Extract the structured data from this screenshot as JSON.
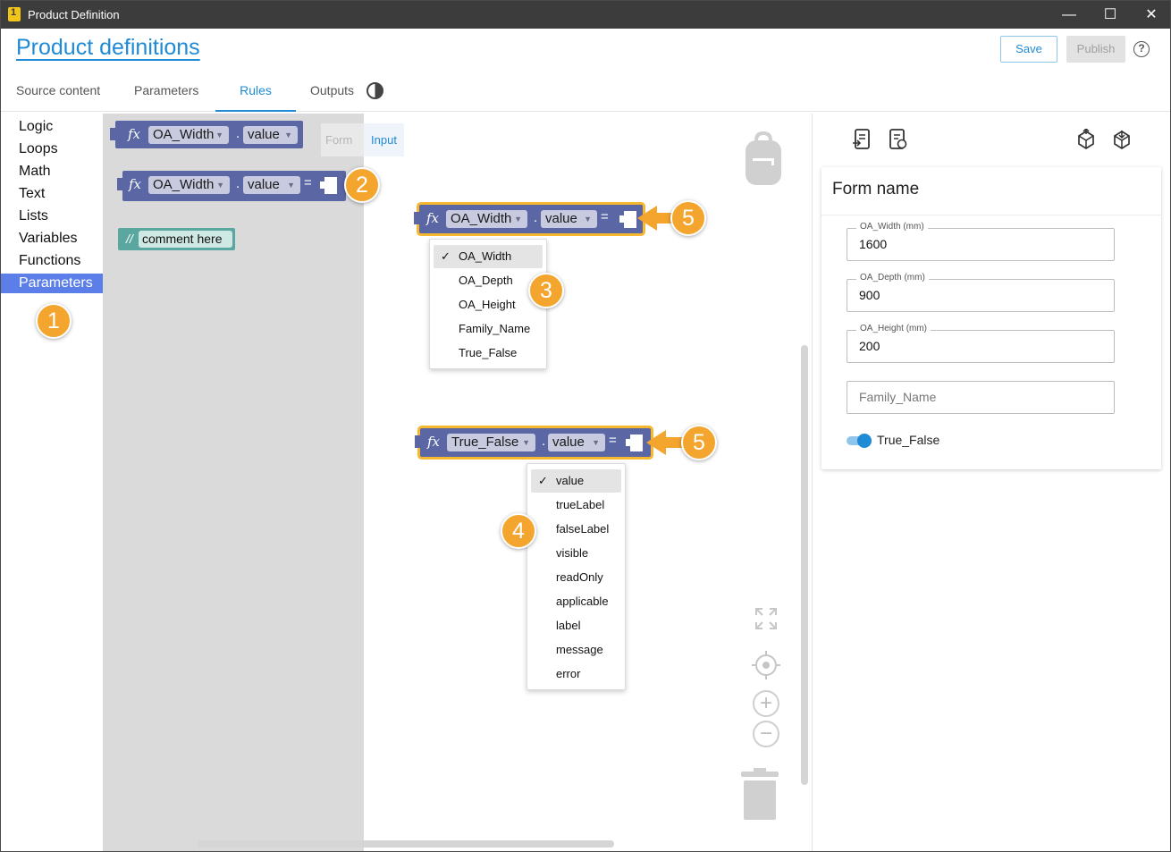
{
  "window": {
    "title": "Product Definition",
    "minimize": "—",
    "maximize": "☐",
    "close": "✕"
  },
  "header": {
    "title": "Product definitions",
    "save_label": "Save",
    "publish_label": "Publish",
    "help": "?"
  },
  "tabs": [
    {
      "label": "Source content"
    },
    {
      "label": "Parameters"
    },
    {
      "label": "Rules",
      "active": true
    },
    {
      "label": "Outputs"
    }
  ],
  "categories": [
    "Logic",
    "Loops",
    "Math",
    "Text",
    "Lists",
    "Variables",
    "Functions",
    "Parameters"
  ],
  "selected_category": "Parameters",
  "flyout_tabs": {
    "form": "Form",
    "input": "Input"
  },
  "flyout_blocks": {
    "getter": {
      "fx": "fx",
      "param": "OA_Width",
      "prop": "value",
      "dot": "."
    },
    "setter": {
      "fx": "fx",
      "param": "OA_Width",
      "prop": "value",
      "dot": ".",
      "eq": "="
    },
    "comment": {
      "slash": "//",
      "text": "comment here"
    }
  },
  "workspace_blocks": {
    "block1": {
      "fx": "fx",
      "param": "OA_Width",
      "prop": "value",
      "dot": ".",
      "eq": "="
    },
    "block2": {
      "fx": "fx",
      "param": "True_False",
      "prop": "value",
      "dot": ".",
      "eq": "="
    }
  },
  "param_menu": {
    "checked": "OA_Width",
    "items": [
      "OA_Width",
      "OA_Depth",
      "OA_Height",
      "Family_Name",
      "True_False"
    ]
  },
  "prop_menu": {
    "checked": "value",
    "items": [
      "value",
      "trueLabel",
      "falseLabel",
      "visible",
      "readOnly",
      "applicable",
      "label",
      "message",
      "error"
    ]
  },
  "callouts": [
    "1",
    "2",
    "3",
    "4",
    "5",
    "5"
  ],
  "check_mark": "✓",
  "caret": "▼",
  "form": {
    "name": "Form name",
    "fields": [
      {
        "label": "OA_Width (mm)",
        "value": "1600"
      },
      {
        "label": "OA_Depth (mm)",
        "value": "900"
      },
      {
        "label": "OA_Height (mm)",
        "value": "200"
      }
    ],
    "text_field_placeholder": "Family_Name",
    "toggle": {
      "label": "True_False",
      "on": true
    }
  },
  "colors": {
    "accent": "#1f8ad6",
    "block": "#5b67a5",
    "comment_block": "#5aa7a0",
    "callout": "#f4a52e",
    "selected_category": "#5c7ee8"
  },
  "icons": [
    "backpack-icon",
    "trash-icon",
    "fit-screen-icon",
    "recenter-icon",
    "zoom-in-icon",
    "zoom-out-icon",
    "import-rules-icon",
    "reload-rules-icon",
    "cube-up-icon",
    "cube-down-icon",
    "contrast-icon",
    "help-icon"
  ]
}
